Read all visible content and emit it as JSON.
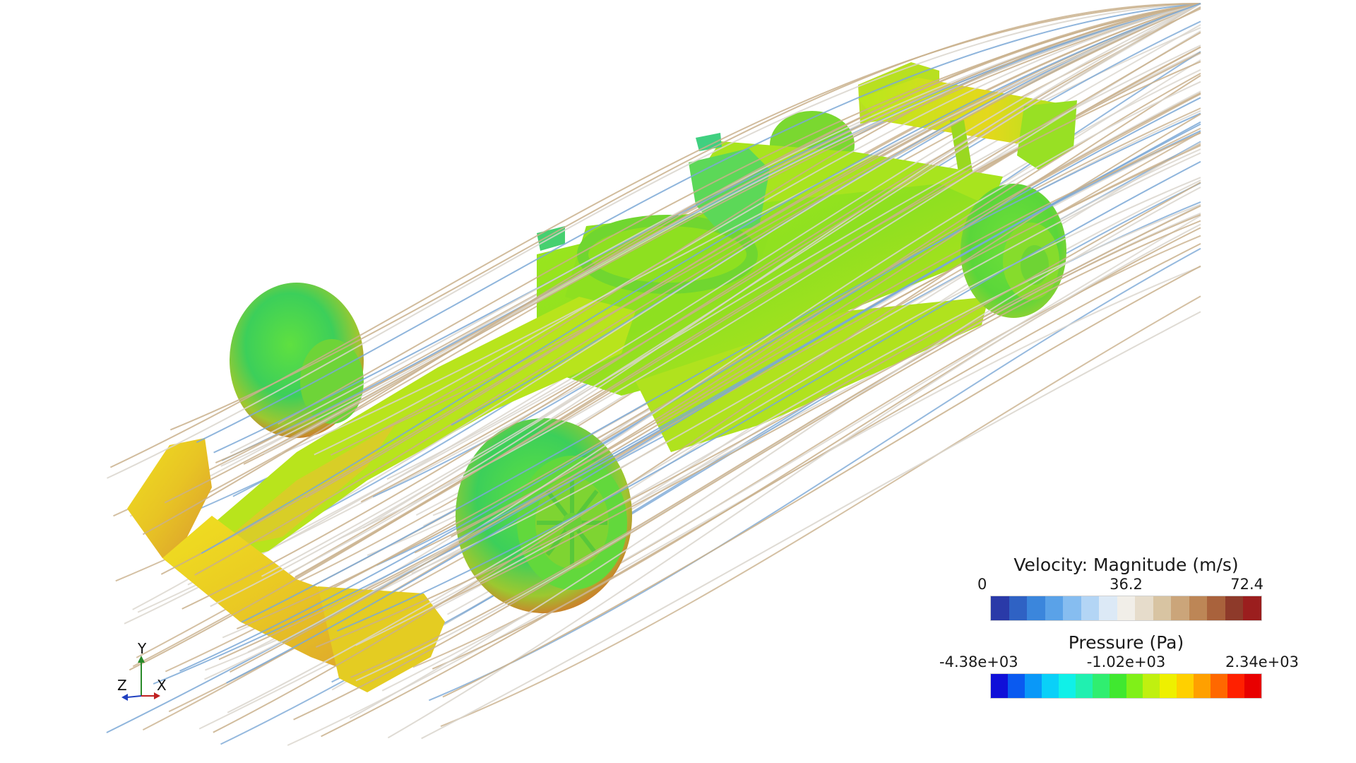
{
  "legends": {
    "velocity": {
      "title": "Velocity: Magnitude (m/s)",
      "min": "0",
      "mid": "36.2",
      "max": "72.4",
      "colors": [
        "#2a3aa8",
        "#2f62c4",
        "#3b86dc",
        "#5aa2e8",
        "#86bdf0",
        "#b3d5f5",
        "#dce9f6",
        "#f1eee8",
        "#e6dccb",
        "#d8c4a2",
        "#cba57a",
        "#bd8656",
        "#a9623c",
        "#8e3a2a",
        "#9b1e1e"
      ]
    },
    "pressure": {
      "title": "Pressure (Pa)",
      "min": "-4.38e+03",
      "mid": "-1.02e+03",
      "max": "2.34e+03",
      "colors": [
        "#1010d8",
        "#0a5af0",
        "#0a98f8",
        "#0ad0f8",
        "#10f0e8",
        "#20f0b0",
        "#30ee70",
        "#40e830",
        "#80f018",
        "#c0f010",
        "#eef000",
        "#ffd000",
        "#ffa000",
        "#ff6800",
        "#ff2000",
        "#e80000"
      ]
    }
  },
  "axis_triad": {
    "y": "Y",
    "z": "Z",
    "x": "X"
  },
  "colors": {
    "body_base": "#86e020",
    "body_mid": "#b8e81c",
    "body_warm": "#e8d41a",
    "stagnation": "#d8832a",
    "suction": "#2ad28a",
    "streamline_warm": "#c9b08c",
    "streamline_light": "#d9d5cc",
    "streamline_cool": "#7ba8d6"
  }
}
